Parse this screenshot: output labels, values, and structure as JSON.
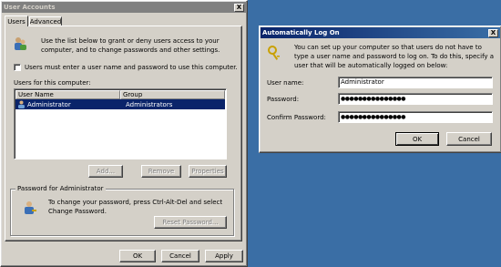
{
  "user_accounts": {
    "title": "User Accounts",
    "close_label": "X",
    "tabs": [
      {
        "label": "Users"
      },
      {
        "label": "Advanced"
      }
    ],
    "intro_text": "Use the list below to grant or deny users access to your computer, and to change passwords and other settings.",
    "checkbox_label": "Users must enter a user name and password to use this computer.",
    "users_group_label": "Users for this computer:",
    "columns": [
      "User Name",
      "Group"
    ],
    "rows": [
      {
        "user": "Administrator",
        "group": "Administrators"
      }
    ],
    "add_label": "Add...",
    "remove_label": "Remove",
    "properties_label": "Properties",
    "password_group_label": "Password for Administrator",
    "password_text": "To change your password, press Ctrl-Alt-Del and select Change Password.",
    "reset_label": "Reset Password...",
    "ok_label": "OK",
    "cancel_label": "Cancel",
    "apply_label": "Apply"
  },
  "auto_logon": {
    "title": "Automatically Log On",
    "close_label": "X",
    "description": "You can set up your computer so that users do not have to type a user name and password to log on. To do this, specify a user that will be automatically logged on below:",
    "username_label": "User name:",
    "username_value": "Administrator",
    "password_label": "Password:",
    "password_value": "●●●●●●●●●●●●●●●",
    "confirm_label": "Confirm Password:",
    "confirm_value": "●●●●●●●●●●●●●●●",
    "ok_label": "OK",
    "cancel_label": "Cancel"
  },
  "colors": {
    "desktop": "#3a6ea5",
    "selection": "#0a246a",
    "face": "#d4d0c8"
  }
}
